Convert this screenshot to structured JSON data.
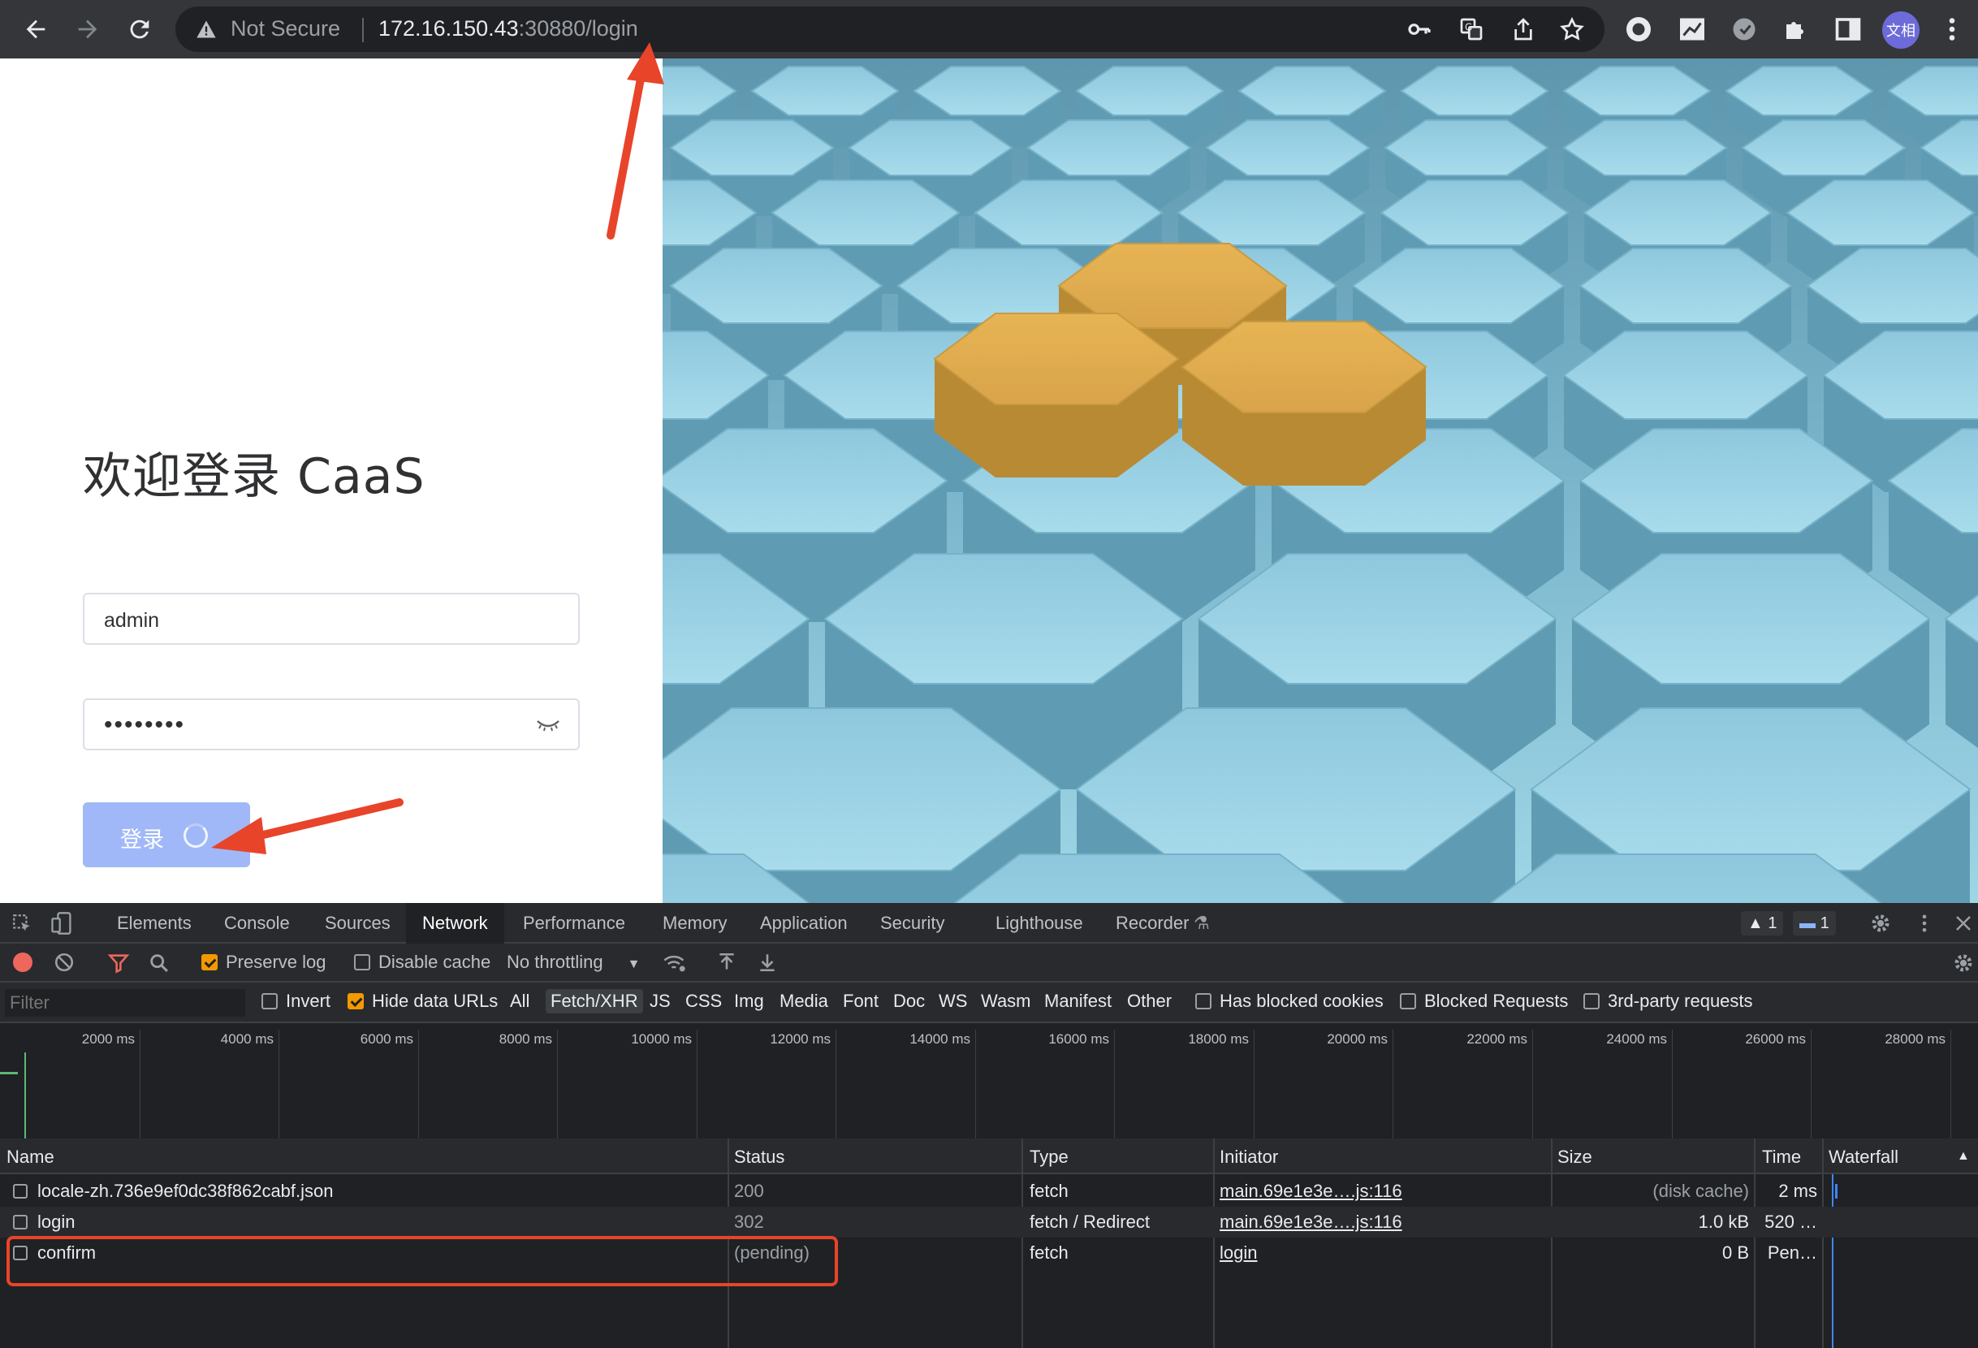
{
  "browser": {
    "security_label": "Not Secure",
    "url_host": "172.16.150.43",
    "url_rest": ":30880/login",
    "profile_label": "文相"
  },
  "login": {
    "title": "欢迎登录 CaaS",
    "username_value": "admin",
    "password_value": "••••••••",
    "submit_label": "登录"
  },
  "devtools": {
    "tabs": [
      "Elements",
      "Console",
      "Sources",
      "Network",
      "Performance",
      "Memory",
      "Application",
      "Security",
      "Lighthouse",
      "Recorder"
    ],
    "active_tab": "Network",
    "warnings_count": "1",
    "messages_count": "1",
    "toolbar": {
      "preserve_log": "Preserve log",
      "disable_cache": "Disable cache",
      "throttling": "No throttling"
    },
    "filter": {
      "placeholder": "Filter",
      "invert": "Invert",
      "hide_data_urls": "Hide data URLs",
      "types": [
        "All",
        "Fetch/XHR",
        "JS",
        "CSS",
        "Img",
        "Media",
        "Font",
        "Doc",
        "WS",
        "Wasm",
        "Manifest",
        "Other"
      ],
      "active_type": "Fetch/XHR",
      "has_blocked_cookies": "Has blocked cookies",
      "blocked_requests": "Blocked Requests",
      "third_party": "3rd-party requests"
    },
    "timeline_ticks": [
      "2000 ms",
      "4000 ms",
      "6000 ms",
      "8000 ms",
      "10000 ms",
      "12000 ms",
      "14000 ms",
      "16000 ms",
      "18000 ms",
      "20000 ms",
      "22000 ms",
      "24000 ms",
      "26000 ms",
      "28000 ms"
    ],
    "columns": [
      "Name",
      "Status",
      "Type",
      "Initiator",
      "Size",
      "Time",
      "Waterfall"
    ],
    "requests": [
      {
        "name": "locale-zh.736e9ef0dc38f862cabf.json",
        "status": "200",
        "type": "fetch",
        "initiator": "main.69e1e3e….js:116",
        "size": "(disk cache)",
        "time": "2 ms"
      },
      {
        "name": "login",
        "status": "302",
        "type": "fetch / Redirect",
        "initiator": "main.69e1e3e….js:116",
        "size": "1.0 kB",
        "time": "520 …"
      },
      {
        "name": "confirm",
        "status": "(pending)",
        "type": "fetch",
        "initiator": "login",
        "size": "0 B",
        "time": "Pen…"
      }
    ]
  },
  "colors": {
    "annotation_red": "#e8442a",
    "login_button": "#a0b8f7",
    "hex_blue": "#86c3da",
    "hex_gold": "#d9a94a"
  }
}
